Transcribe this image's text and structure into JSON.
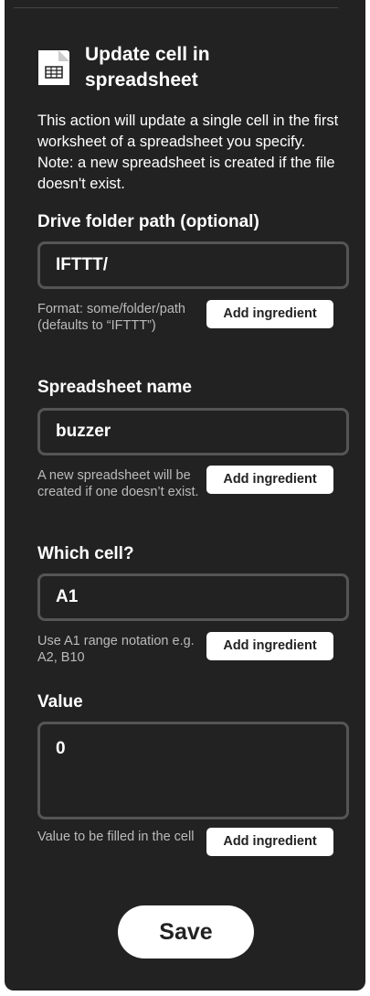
{
  "action": {
    "title": "Update cell in spreadsheet",
    "description": "This action will update a single cell in the first worksheet of a spreadsheet you specify. Note: a new spreadsheet is created if the file doesn't exist."
  },
  "fields": [
    {
      "label": "Drive folder path (optional)",
      "value": "IFTTT/",
      "help": "Format: some/folder/path (defaults to “IFTTT”)",
      "button": "Add ingredient"
    },
    {
      "label": "Spreadsheet name",
      "value": "buzzer",
      "help": "A new spreadsheet will be created if one doesn’t exist.",
      "button": "Add ingredient"
    },
    {
      "label": "Which cell?",
      "value": "A1",
      "help": "Use A1 range notation e.g. A2, B10",
      "button": "Add ingredient"
    },
    {
      "label": "Value",
      "value": "0",
      "help": "Value to be filled in the cell",
      "button": "Add ingredient"
    }
  ],
  "save_label": "Save",
  "icons": {
    "action": "spreadsheet-icon"
  },
  "colors": {
    "panel": "#222222",
    "field_border": "#555555",
    "button_bg": "#ffffff"
  }
}
